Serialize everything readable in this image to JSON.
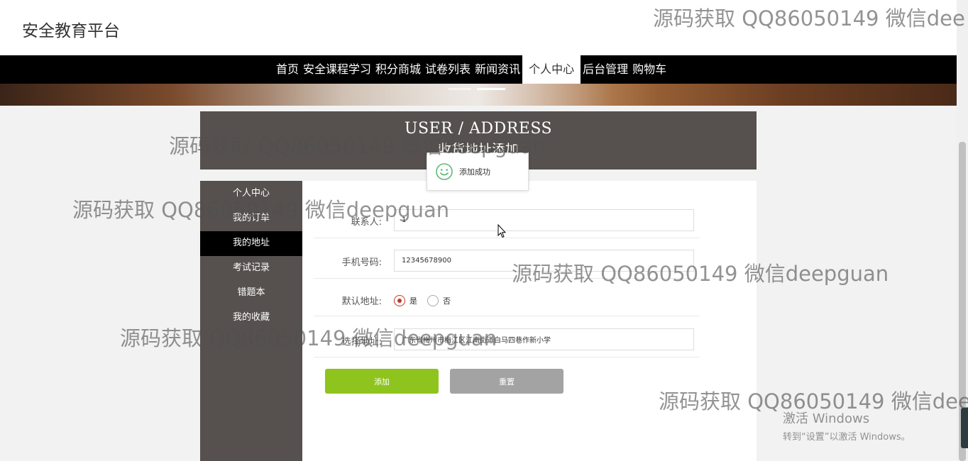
{
  "header": {
    "site_title": "安全教育平台"
  },
  "nav": {
    "items": [
      "首页",
      "安全课程学习",
      "积分商城",
      "试卷列表",
      "新闻资讯",
      "个人中心",
      "后台管理",
      "购物车"
    ],
    "active_index": 5
  },
  "page_head": {
    "title_en": "USER / ADDRESS",
    "title_cn": "收货地址添加"
  },
  "toast": {
    "icon": "smile-icon",
    "text": "添加成功"
  },
  "sidebar": {
    "items": [
      "个人中心",
      "我的订单",
      "我的地址",
      "考试记录",
      "错题本",
      "我的收藏"
    ],
    "active_index": 2
  },
  "form": {
    "contact_label": "联系人:",
    "contact_value": "1",
    "phone_label": "手机号码:",
    "phone_value": "12345678900",
    "default_label": "默认地址:",
    "default_options": [
      "是",
      "否"
    ],
    "default_selected": "是",
    "address_label": "选择地址:",
    "address_value": "广东省梅州市梅江区江南街道白马四巷作新小学",
    "add_label": "添加",
    "reset_label": "重置"
  },
  "watermark": {
    "text": "源码获取 QQ86050149 微信deepguan",
    "text_clipped": "源码获取 QQ86050149 微信dee"
  },
  "os_overlay": {
    "activate_title": "激活 Windows",
    "activate_sub": "转到“设置”以激活 Windows。"
  },
  "colors": {
    "add_button": "#8fc41f",
    "reset_button": "#a3a3a3",
    "sidebar_bg": "#56504e",
    "nav_bg": "#000000",
    "radio_checked": "#c0392b"
  }
}
